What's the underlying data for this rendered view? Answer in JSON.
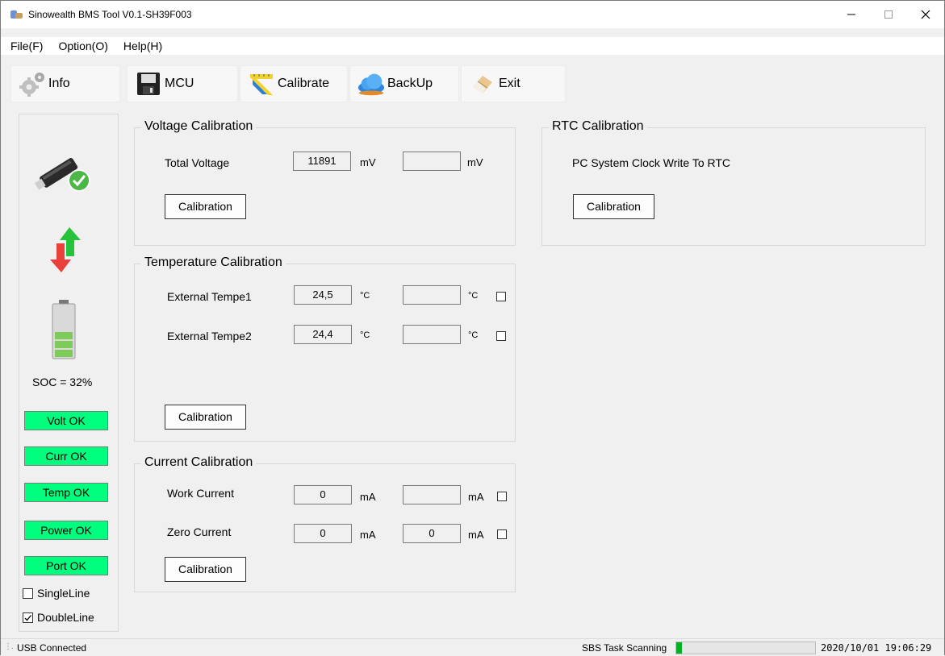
{
  "window": {
    "title": "Sinowealth BMS Tool V0.1-SH39F003"
  },
  "menu": [
    {
      "label": "File(F)"
    },
    {
      "label": "Option(O)"
    },
    {
      "label": "Help(H)"
    }
  ],
  "toolbar": [
    {
      "label": "Info",
      "icon": "gear-icon"
    },
    {
      "label": "MCU",
      "icon": "floppy-icon"
    },
    {
      "label": "Calibrate",
      "icon": "ruler-icon"
    },
    {
      "label": "BackUp",
      "icon": "cloud-icon"
    },
    {
      "label": "Exit",
      "icon": "eraser-icon"
    }
  ],
  "left_panel": {
    "soc_label": "SOC = 32%",
    "soc_percent": 32,
    "badges": [
      {
        "label": "Volt OK",
        "color": "#00ff7f"
      },
      {
        "label": "Curr OK",
        "color": "#00ff7f"
      },
      {
        "label": "Temp OK",
        "color": "#00ff7f"
      },
      {
        "label": "Power OK",
        "color": "#00ff7f"
      },
      {
        "label": "Port OK",
        "color": "#00ff7f"
      }
    ],
    "single_line": {
      "label": "SingleLine",
      "checked": false
    },
    "double_line": {
      "label": "DoubleLine",
      "checked": true
    }
  },
  "voltage": {
    "title": "Voltage Calibration",
    "label": "Total Voltage",
    "value": "11891",
    "unit": "mV",
    "input": "",
    "input_unit": "mV",
    "button": "Calibration"
  },
  "temperature": {
    "title": "Temperature Calibration",
    "rows": [
      {
        "label": "External Tempe1",
        "value": "24,5",
        "unit": "°C",
        "input": "",
        "input_unit": "°C"
      },
      {
        "label": "External Tempe2",
        "value": "24,4",
        "unit": "°C",
        "input": "",
        "input_unit": "°C"
      }
    ],
    "button": "Calibration"
  },
  "current": {
    "title": "Current Calibration",
    "rows": [
      {
        "label": "Work Current",
        "value": "0",
        "unit": "mA",
        "input": "",
        "input_unit": "mA"
      },
      {
        "label": "Zero Current",
        "value": "0",
        "unit": "mA",
        "input": "0",
        "input_unit": "mA"
      }
    ],
    "button": "Calibration"
  },
  "rtc": {
    "title": "RTC Calibration",
    "text": "PC System Clock Write To RTC",
    "button": "Calibration"
  },
  "statusbar": {
    "connection": "USB Connected",
    "task": "SBS Task Scanning",
    "progress": 0.04,
    "datetime": "2020/10/01 19:06:29",
    "progress_color": "#06b025"
  }
}
